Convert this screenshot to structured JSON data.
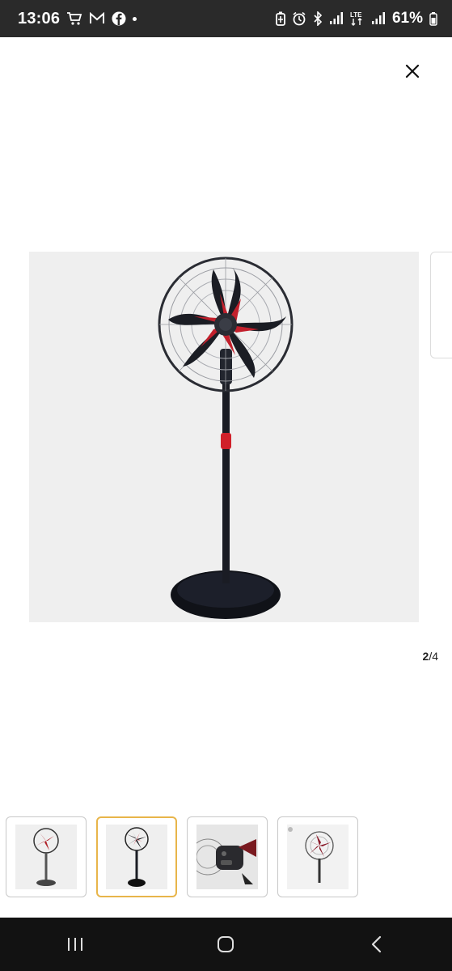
{
  "status_bar": {
    "time": "13:06",
    "battery_percent": "61%",
    "left_icons": [
      "cart-icon",
      "gmail-icon",
      "facebook-icon",
      "dot-icon"
    ],
    "right_icons": [
      "battery-saver-icon",
      "alarm-icon",
      "bluetooth-icon",
      "signal-icon",
      "lte-icon",
      "signal-icon-2",
      "battery-icon"
    ],
    "network": "LTE"
  },
  "gallery": {
    "current": "2",
    "separator": "/",
    "total": "4",
    "close_icon": "close-icon",
    "thumbnails": [
      {
        "label": "fan-front-view",
        "selected": false
      },
      {
        "label": "fan-black-base",
        "selected": true
      },
      {
        "label": "fan-control-closeup",
        "selected": false
      },
      {
        "label": "fan-red-blades",
        "selected": false
      }
    ],
    "selected_border_color": "#e8b54a"
  },
  "nav_bar": {
    "buttons": [
      "recents-icon",
      "home-icon",
      "back-icon"
    ]
  }
}
